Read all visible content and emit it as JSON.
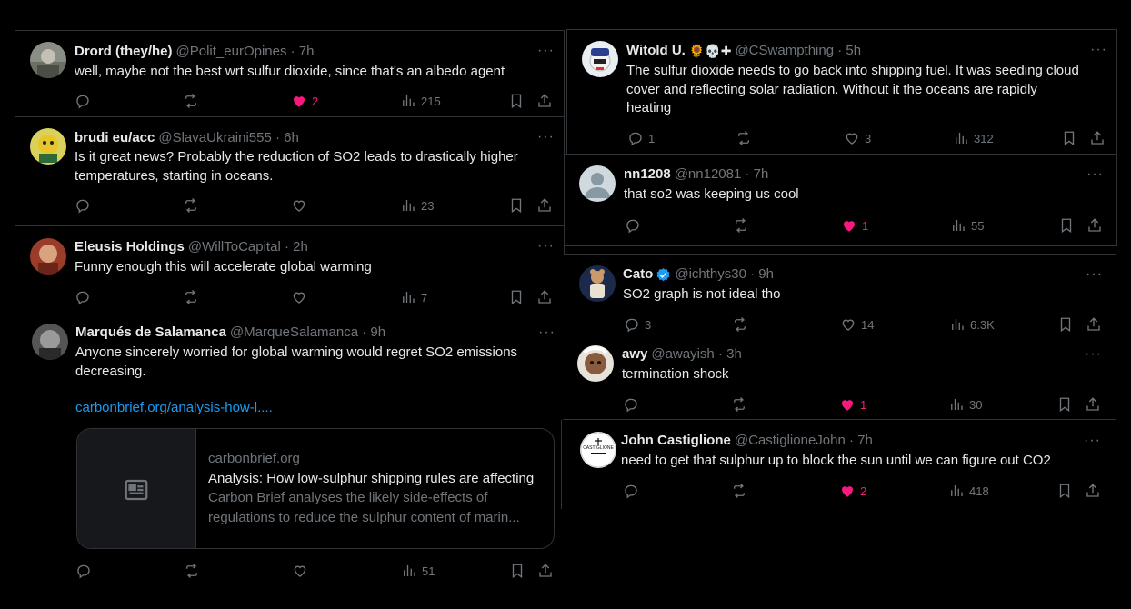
{
  "tweets": [
    {
      "name": "Drord (they/he)",
      "handle": "@Polit_eurOpines · 7h",
      "text": [
        "well, maybe not the best wrt sulfur dioxide, since that's an albedo agent"
      ],
      "replies": "",
      "retweets": "",
      "likes": "2",
      "liked": true,
      "views": "215"
    },
    {
      "name": "brudi eu/acc",
      "handle": "@SlavaUkraini555 · 6h",
      "text": [
        "Is it great news? Probably the reduction of SO2 leads to drastically higher",
        "temperatures, starting in oceans."
      ],
      "replies": "",
      "retweets": "",
      "likes": "",
      "liked": false,
      "views": "23"
    },
    {
      "name": "Eleusis Holdings",
      "handle": "@WillToCapital · 2h",
      "text": [
        "Funny enough this will accelerate global warming"
      ],
      "replies": "",
      "retweets": "",
      "likes": "",
      "liked": false,
      "views": "7"
    },
    {
      "name": "Marqués de Salamanca",
      "handle": "@MarqueSalamanca · 9h",
      "text": [
        "Anyone sincerely worried for global warming would regret SO2 emissions",
        "decreasing."
      ],
      "link": "carbonbrief.org/analysis-how-l....",
      "card": {
        "domain": "carbonbrief.org",
        "title": "Analysis: How low-sulphur shipping rules are affecting",
        "desc1": "Carbon Brief analyses the likely side-effects of",
        "desc2": "regulations to reduce the sulphur content of marin..."
      },
      "replies": "",
      "retweets": "",
      "likes": "",
      "liked": false,
      "views": "51"
    },
    {
      "name": "Witold U.",
      "emoji": "🌻💀✚",
      "handle": "@CSwampthing · 5h",
      "text": [
        "The sulfur dioxide needs to go back into shipping fuel. It was seeding cloud",
        "cover and reflecting solar radiation. Without it the oceans are rapidly",
        "heating"
      ],
      "replies": "1",
      "retweets": "",
      "likes": "3",
      "liked": false,
      "views": "312"
    },
    {
      "name": "nn1208",
      "handle": "@nn12081 · 7h",
      "text": [
        "that so2 was keeping us cool"
      ],
      "replies": "",
      "retweets": "",
      "likes": "1",
      "liked": true,
      "views": "55"
    },
    {
      "name": "Cato",
      "handle": "@ichthys30 · 9h",
      "text": [
        "SO2 graph is not ideal tho"
      ],
      "replies": "3",
      "retweets": "",
      "likes": "14",
      "liked": false,
      "views": "6.3K"
    },
    {
      "name": "awy",
      "handle": "@awayish · 3h",
      "text": [
        "termination shock"
      ],
      "replies": "",
      "retweets": "",
      "likes": "1",
      "liked": true,
      "views": "30"
    },
    {
      "name": "John Castiglione",
      "handle": "@CastiglioneJohn · 7h",
      "text": [
        "need to get that sulphur up to block the sun until we can figure out CO2"
      ],
      "replies": "",
      "retweets": "",
      "likes": "2",
      "liked": true,
      "views": "418"
    }
  ],
  "more_label": "···",
  "icons": {
    "reply": "reply-icon",
    "retweet": "retweet-icon",
    "like": "heart-icon",
    "views": "views-icon",
    "bookmark": "bookmark-icon",
    "share": "share-icon",
    "more": "more-icon",
    "verified": "verified-badge-icon",
    "article": "article-icon"
  },
  "colors": {
    "background": "#000000",
    "text": "#e7e9ea",
    "muted": "#71767b",
    "like": "#f91880",
    "link": "#1d9bf0",
    "verified": "#1d9bf0",
    "border": "#2f3336"
  }
}
